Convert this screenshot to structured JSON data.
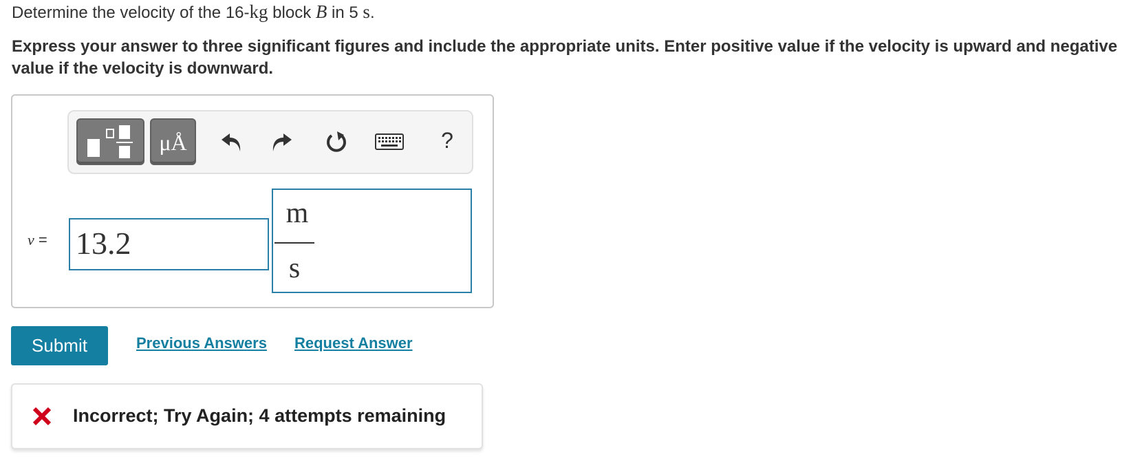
{
  "question": {
    "part1": "Determine the velocity of the 16-",
    "unit_mass": "kg",
    "part2": " block ",
    "block": "B",
    "part3": " in 5 ",
    "unit_time": "s",
    "part4": "."
  },
  "instructions": "Express your answer to three significant figures and include the appropriate units. Enter positive value if the velocity is upward and negative value if the velocity is downward.",
  "toolbar": {
    "buttons": [
      "templates-icon",
      "units-icon",
      "undo-icon",
      "redo-icon",
      "reset-icon",
      "keyboard-icon",
      "help-icon"
    ],
    "units_label": "μÅ",
    "help_label": "?"
  },
  "answer": {
    "variable": "v",
    "equals": " =",
    "value": "13.2",
    "unit_numerator": "m",
    "unit_denominator": "s"
  },
  "actions": {
    "submit_label": "Submit",
    "previous_answers_label": "Previous Answers",
    "request_answer_label": "Request Answer"
  },
  "feedback": {
    "text": "Incorrect; Try Again; 4 attempts remaining",
    "status_color": "#d0021b"
  },
  "colors": {
    "accent": "#157fa1",
    "input_border": "#2a7fa8"
  }
}
